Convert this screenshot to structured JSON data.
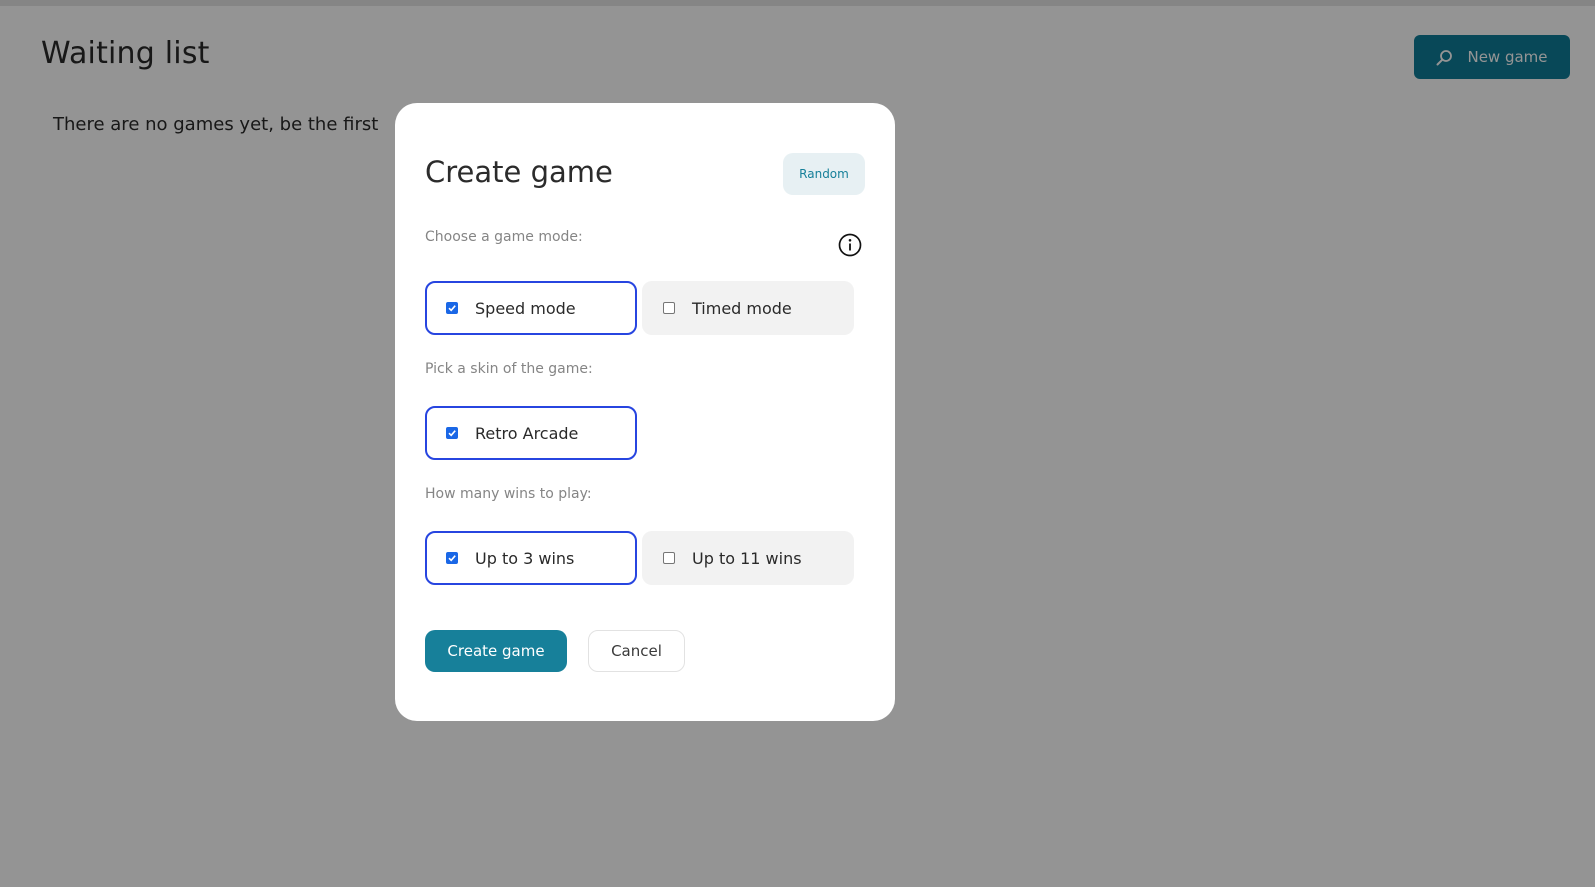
{
  "page": {
    "title": "Waiting list",
    "empty_message": "There are no games yet, be the first",
    "new_game_button": {
      "label": "New game",
      "icon": "search-icon"
    }
  },
  "modal": {
    "title": "Create game",
    "random_button": "Random",
    "info_icon": "info-icon",
    "game_mode": {
      "label": "Choose a game mode:",
      "options": [
        {
          "label": "Speed mode",
          "checked": true
        },
        {
          "label": "Timed mode",
          "checked": false
        }
      ]
    },
    "skin": {
      "label": "Pick a skin of the game:",
      "options": [
        {
          "label": "Retro Arcade",
          "checked": true
        }
      ]
    },
    "wins": {
      "label": "How many wins to play:",
      "options": [
        {
          "label": "Up to 3 wins",
          "checked": true
        },
        {
          "label": "Up to 11 wins",
          "checked": false
        }
      ]
    },
    "create_button": "Create game",
    "cancel_button": "Cancel"
  },
  "colors": {
    "primary": "#17809a",
    "selected_border": "#2745e0",
    "overlay": "rgba(0,0,0,0.42)"
  }
}
